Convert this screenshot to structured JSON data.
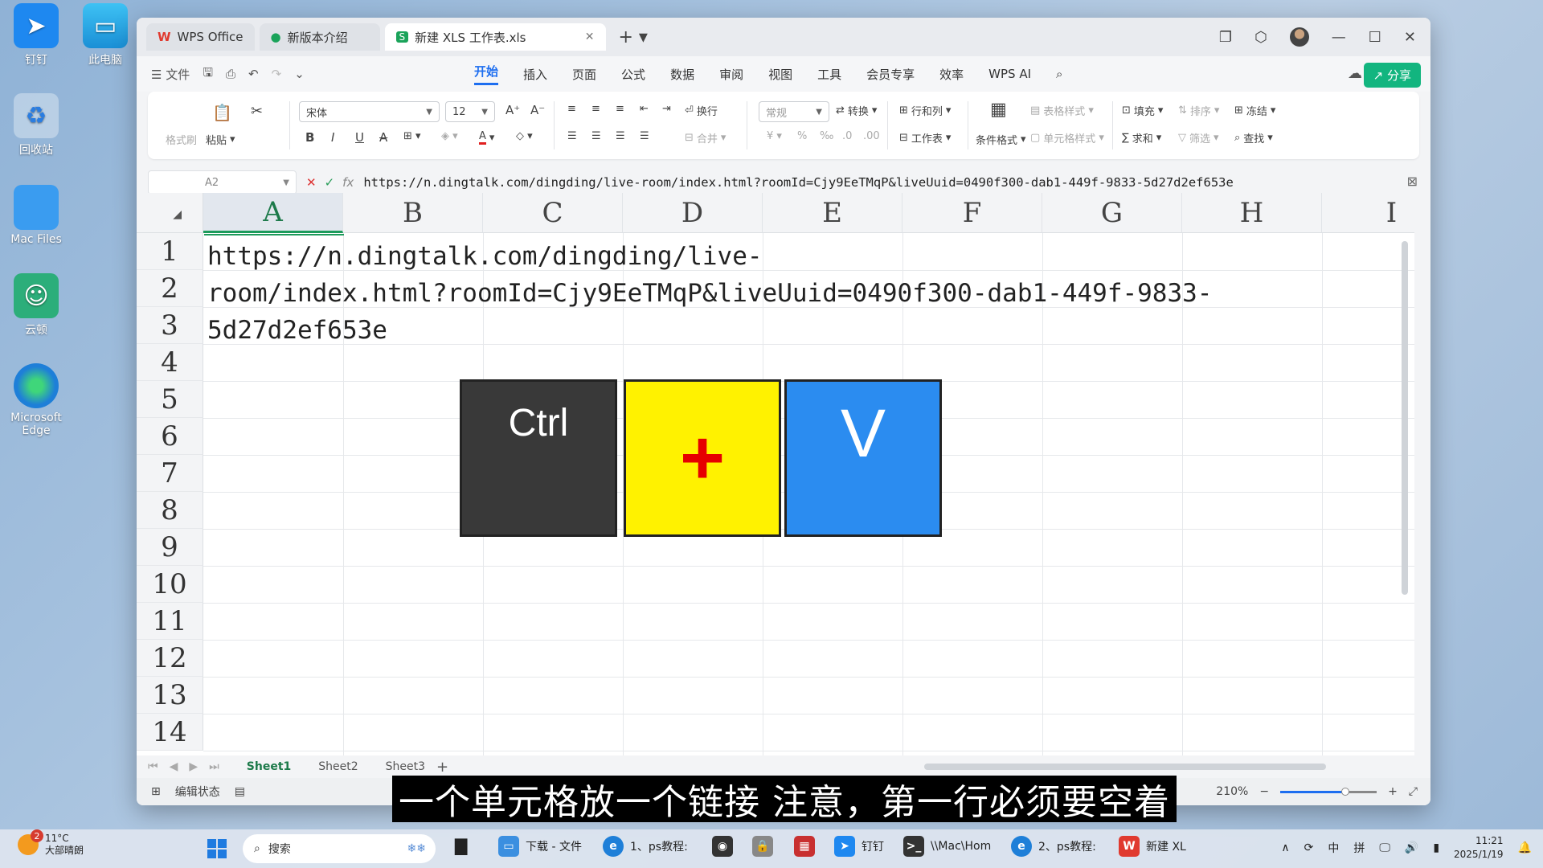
{
  "desktop": {
    "icons": [
      {
        "label": "钉钉",
        "icon": "dingtalk-icon"
      },
      {
        "label": "此电脑",
        "icon": "computer-icon"
      },
      {
        "label": "回收站",
        "icon": "recycle-bin-icon"
      },
      {
        "label": "Mac Files",
        "icon": "folder-icon"
      },
      {
        "label": "云顿",
        "icon": "app-icon"
      },
      {
        "label": "Microsoft Edge",
        "icon": "edge-icon"
      }
    ]
  },
  "window": {
    "tabs": [
      {
        "label": "WPS Office"
      },
      {
        "label": "新版本介绍"
      },
      {
        "label": "新建 XLS 工作表.xls"
      }
    ],
    "menu": {
      "file": "文件",
      "tabs": [
        "开始",
        "插入",
        "页面",
        "公式",
        "数据",
        "审阅",
        "视图",
        "工具",
        "会员专享",
        "效率",
        "WPS AI"
      ],
      "active_tab": "开始",
      "share": "分享"
    },
    "ribbon": {
      "format_painter": "格式刷",
      "paste": "粘贴",
      "font_name": "宋体",
      "font_size": "12",
      "wrap": "换行",
      "number_format": "常规",
      "convert": "转换",
      "row_col": "行和列",
      "table_style": "表格样式",
      "fill": "填充",
      "sort": "排序",
      "freeze": "冻结",
      "merge": "合并",
      "worksheet": "工作表",
      "cond_format": "条件格式",
      "cell_style": "单元格样式",
      "sum": "求和",
      "filter": "筛选",
      "find": "查找"
    },
    "formula_bar": {
      "name_box": "A2",
      "fx": "fx",
      "content": "https://n.dingtalk.com/dingding/live-room/index.html?roomId=Cjy9EeTMqP&liveUuid=0490f300-dab1-449f-9833-5d27d2ef653e"
    },
    "grid": {
      "columns": [
        "A",
        "B",
        "C",
        "D",
        "E",
        "F",
        "G",
        "H",
        "I"
      ],
      "rows": [
        "1",
        "2",
        "3",
        "4",
        "5",
        "6",
        "7",
        "8",
        "9",
        "10",
        "11",
        "12",
        "13",
        "14"
      ],
      "cell_lines": [
        "https://n.dingtalk.com/dingding/live-",
        "room/index.html?roomId=Cjy9EeTMqP&liveUuid=0490f300-dab1-449f-9833-",
        "5d27d2ef653e"
      ]
    },
    "overlay_keys": {
      "key1": "Ctrl",
      "key2": "+",
      "key3": "V"
    },
    "sheets": [
      "Sheet1",
      "Sheet2",
      "Sheet3"
    ],
    "add_sheet": "+",
    "status": {
      "mode": "编辑状态",
      "zoom": "210%"
    }
  },
  "subtitle": "一个单元格放一个链接 注意，第一行必须要空着",
  "taskbar": {
    "weather_temp": "11°C",
    "weather_desc": "大部晴朗",
    "weather_badge": "2",
    "search": "搜索",
    "items": [
      "下载 - 文件",
      "1、ps教程:",
      "钉钉",
      "\\\\Mac\\Hom",
      "2、ps教程:",
      "新建 XL"
    ],
    "ime1": "中",
    "ime2": "拼",
    "time": "11:21",
    "date": "2025/1/19"
  },
  "colors": {
    "accent_green": "#1d9b5b",
    "wps_blue": "#1d6ef0",
    "share_green": "#12b57f",
    "key_yellow": "#fff200",
    "key_blue": "#2b8cf0",
    "key_dark": "#393939"
  }
}
